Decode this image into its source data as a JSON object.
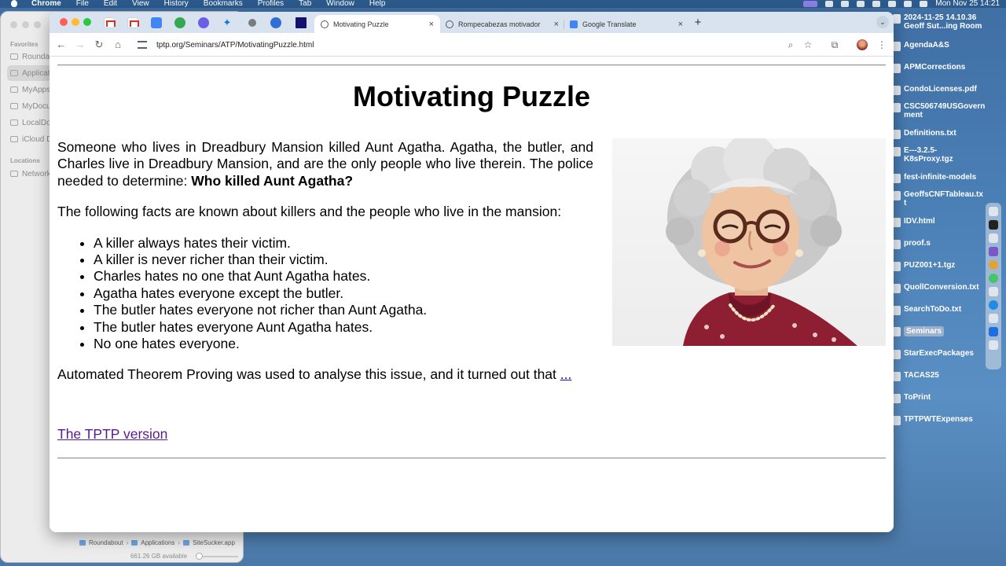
{
  "menubar": {
    "app": "Chrome",
    "items": [
      "File",
      "Edit",
      "View",
      "History",
      "Bookmarks",
      "Profiles",
      "Tab",
      "Window",
      "Help"
    ],
    "clock": "Mon Nov 25  14:21"
  },
  "finder": {
    "sections": {
      "favorites": "Favorites",
      "locations": "Locations"
    },
    "favorites": [
      "Roundabout",
      "Applications",
      "MyApps",
      "MyDocuments",
      "LocalDocs",
      "iCloud Drive"
    ],
    "locations": [
      "Network"
    ],
    "path": [
      "Roundabout",
      "Applications",
      "SiteSucker.app"
    ],
    "available": "661.26 GB available"
  },
  "desktop": {
    "items": [
      "2024-11-25 14.10.36 Geoff Sut...ing Room",
      "AgendaA&S",
      "APMCorrections",
      "CondoLicenses.pdf",
      "CSC506749USGovernment",
      "Definitions.txt",
      "E---3.2.5-K8sProxy.tgz",
      "fest-infinite-models",
      "GeoffsCNFTableau.txt",
      "IDV.html",
      "proof.s",
      "PUZ001+1.tgz",
      "QuollConversion.txt",
      "SearchToDo.txt",
      "Seminars",
      "StarExecPackages",
      "TACAS25",
      "ToPrint",
      "TPTPWTExpenses"
    ],
    "selected": "Seminars"
  },
  "browser": {
    "tabs": [
      {
        "title": "Motivating Puzzle",
        "active": true
      },
      {
        "title": "Rompecabezas motivador",
        "active": false
      },
      {
        "title": "Google Translate",
        "active": false
      }
    ],
    "url": "tptp.org/Seminars/ATP/MotivatingPuzzle.html",
    "close_glyph": "×",
    "newtab_glyph": "+"
  },
  "page": {
    "title": "Motivating Puzzle",
    "intro": "Someone who lives in Dreadbury Mansion killed Aunt Agatha. Agatha, the butler, and Charles live in Dreadbury Mansion, and are the only people who live therein. The police needed to determine: ",
    "question": "Who killed Aunt Agatha?",
    "facts_intro": "The following facts are known about killers and the people who live in the mansion:",
    "facts": [
      "A killer always hates their victim.",
      "A killer is never richer than their victim.",
      "Charles hates no one that Aunt Agatha hates.",
      "Agatha hates everyone except the butler.",
      "The butler hates everyone not richer than Aunt Agatha.",
      "The butler hates everyone Aunt Agatha hates.",
      "No one hates everyone."
    ],
    "conclusion": "Automated Theorem Proving was used to analyse this issue, and it turned out that ",
    "conclusion_link": "...",
    "tptp_link": "The TPTP version"
  }
}
